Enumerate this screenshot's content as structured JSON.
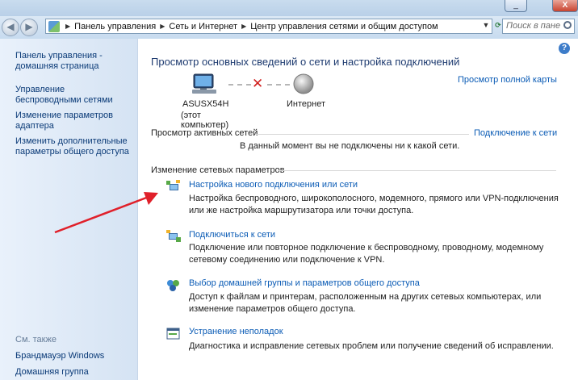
{
  "window": {
    "minimize_label": "_",
    "close_label": "X"
  },
  "address": {
    "crumbs": [
      "Панель управления",
      "Сеть и Интернет",
      "Центр управления сетями и общим доступом"
    ],
    "search_placeholder": "Поиск в пане",
    "icons": [
      "back-icon",
      "forward-icon",
      "refresh-icon",
      "search-icon"
    ]
  },
  "sidebar": {
    "home": "Панель управления - домашняя страница",
    "items": [
      "Управление беспроводными сетями",
      "Изменение параметров адаптера",
      "Изменить дополнительные параметры общего доступа"
    ],
    "see_also": "См. также",
    "see_also_items": [
      "Брандмауэр Windows",
      "Домашняя группа"
    ]
  },
  "main": {
    "title": "Просмотр основных сведений о сети и настройка подключений",
    "full_map_link": "Просмотр полной карты",
    "computer_name": "ASUSX54H",
    "computer_sub": "(этот компьютер)",
    "internet_label": "Интернет",
    "active_networks_heading": "Просмотр активных сетей",
    "connect_link": "Подключение к сети",
    "no_connection": "В данный момент вы не подключены ни к какой сети.",
    "change_heading": "Изменение сетевых параметров",
    "tasks": [
      {
        "title": "Настройка нового подключения или сети",
        "desc": "Настройка беспроводного, широкополосного, модемного, прямого или VPN-подключения или же настройка маршрутизатора или точки доступа."
      },
      {
        "title": "Подключиться к сети",
        "desc": "Подключение или повторное подключение к беспроводному, проводному, модемному сетевому соединению или подключение к VPN."
      },
      {
        "title": "Выбор домашней группы и параметров общего доступа",
        "desc": "Доступ к файлам и принтерам, расположенным на других сетевых компьютерах, или изменение параметров общего доступа."
      },
      {
        "title": "Устранение неполадок",
        "desc": "Диагностика и исправление сетевых проблем или получение сведений об исправлении."
      }
    ]
  },
  "colors": {
    "link": "#0a5bb5",
    "title": "#1e3b70",
    "sidebar_link": "#0a3a77",
    "arrow": "#e0202a"
  }
}
